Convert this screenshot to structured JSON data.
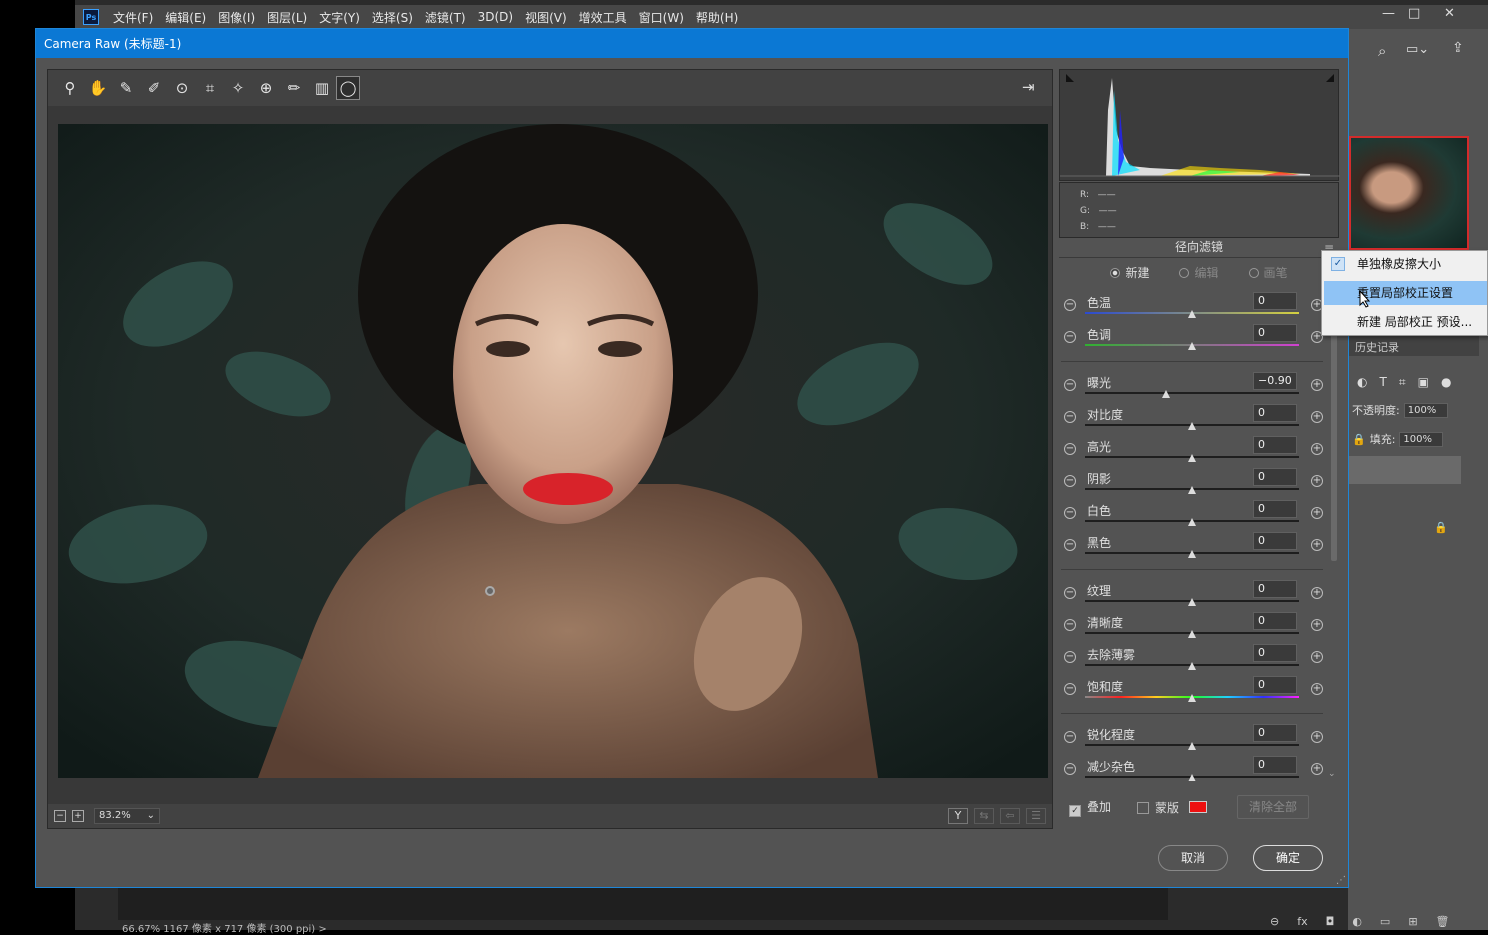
{
  "photoshop": {
    "logo": "Ps",
    "menus": [
      "文件(F)",
      "编辑(E)",
      "图像(I)",
      "图层(L)",
      "文字(Y)",
      "选择(S)",
      "滤镜(T)",
      "3D(D)",
      "视图(V)",
      "增效工具",
      "窗口(W)",
      "帮助(H)"
    ],
    "window_controls": {
      "minimize": "—",
      "restore": "□",
      "close": "✕"
    },
    "history_tab": "历史记录",
    "opacity_label": "不透明度:",
    "opacity_value": "100%",
    "fill_label": "填充:",
    "fill_value": "100%",
    "status_text": "66.67%     1167 像素 x 717 像素 (300 ppi)     >"
  },
  "dialog": {
    "title": "Camera Raw (未标题-1)",
    "tools": [
      "zoom-icon",
      "hand-icon",
      "white-balance-icon",
      "color-sampler-icon",
      "target-adjust-icon",
      "crop-icon",
      "spot-removal-icon",
      "red-eye-icon",
      "adjustment-brush-icon",
      "graduated-filter-icon",
      "radial-filter-icon"
    ],
    "zoom_value": "83.2%",
    "view_icons": [
      "Y",
      "⇆",
      "⇦",
      "☰"
    ],
    "histogram": {
      "r_label": "R:",
      "g_label": "G:",
      "b_label": "B:",
      "r_value": "——",
      "g_value": "——",
      "b_value": "——"
    },
    "panel_title": "径向滤镜",
    "modes": {
      "new": "新建",
      "edit": "编辑",
      "brush": "画笔"
    },
    "sliders": [
      {
        "label": "色温",
        "value": "0",
        "pos": 0.5,
        "track": "temp"
      },
      {
        "label": "色调",
        "value": "0",
        "pos": 0.5,
        "track": "tint"
      },
      {
        "label": "曝光",
        "value": "−0.90",
        "pos": 0.38,
        "track": "plain"
      },
      {
        "label": "对比度",
        "value": "0",
        "pos": 0.5,
        "track": "plain"
      },
      {
        "label": "高光",
        "value": "0",
        "pos": 0.5,
        "track": "plain"
      },
      {
        "label": "阴影",
        "value": "0",
        "pos": 0.5,
        "track": "plain"
      },
      {
        "label": "白色",
        "value": "0",
        "pos": 0.5,
        "track": "plain"
      },
      {
        "label": "黑色",
        "value": "0",
        "pos": 0.5,
        "track": "plain"
      },
      {
        "label": "纹理",
        "value": "0",
        "pos": 0.5,
        "track": "plain"
      },
      {
        "label": "清晰度",
        "value": "0",
        "pos": 0.5,
        "track": "plain"
      },
      {
        "label": "去除薄雾",
        "value": "0",
        "pos": 0.5,
        "track": "plain"
      },
      {
        "label": "饱和度",
        "value": "0",
        "pos": 0.5,
        "track": "sat"
      },
      {
        "label": "锐化程度",
        "value": "0",
        "pos": 0.5,
        "track": "plain"
      },
      {
        "label": "减少杂色",
        "value": "0",
        "pos": 0.5,
        "track": "plain"
      }
    ],
    "overlay_label": "叠加",
    "mask_label": "蒙版",
    "mask_color": "#ee1010",
    "clear_all_label": "清除全部",
    "cancel_label": "取消",
    "ok_label": "确定"
  },
  "dropdown": {
    "items": [
      "单独橡皮擦大小",
      "重置局部校正设置",
      "新建 局部校正 预设..."
    ],
    "checked_index": 0,
    "highlighted_index": 1
  }
}
